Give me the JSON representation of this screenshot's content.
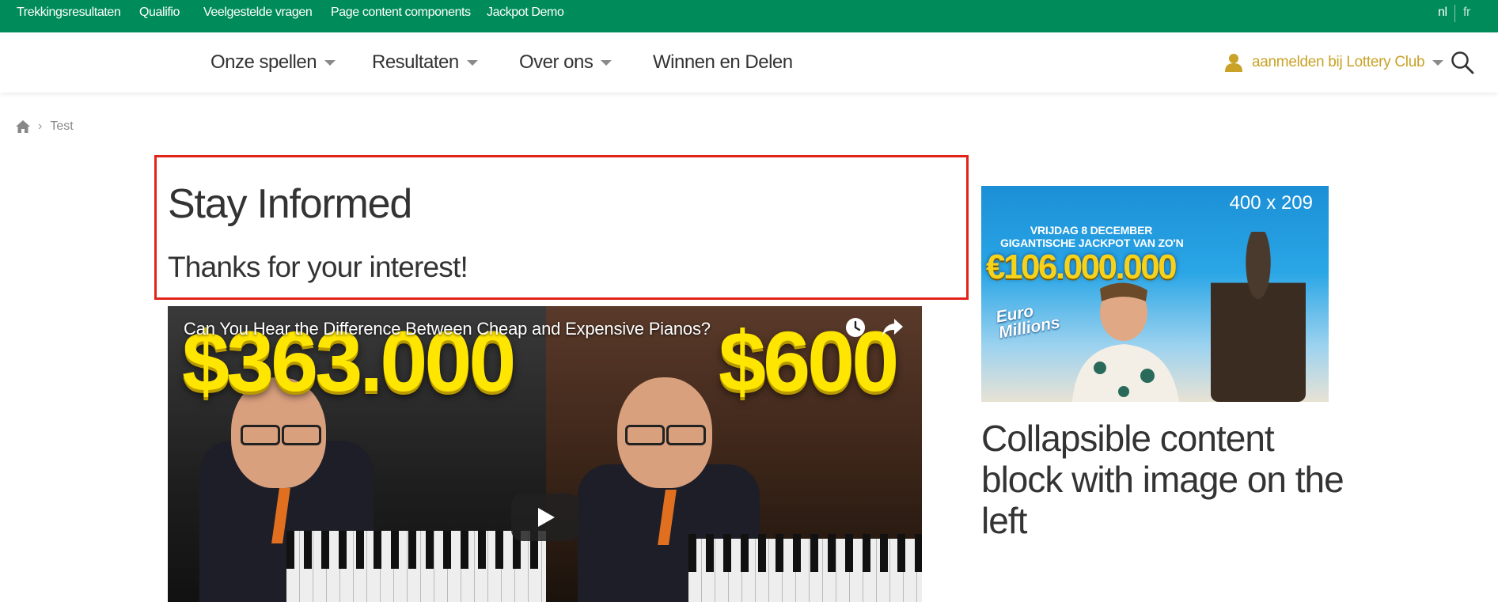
{
  "topbar": {
    "links": [
      "Trekkingsresultaten",
      "Qualifio",
      "Veelgestelde vragen",
      "Page content components",
      "Jackpot Demo"
    ],
    "languages": [
      "nl",
      "fr"
    ],
    "color": "#008c5a"
  },
  "nav": {
    "items": [
      "Onze spellen",
      "Resultaten",
      "Over ons",
      "Winnen en Delen"
    ],
    "login_label": "aanmelden bij Lottery Club",
    "accent_color": "#c9a227"
  },
  "breadcrumb": {
    "current": "Test"
  },
  "main": {
    "heading": "Stay Informed",
    "subheading": "Thanks for your interest!",
    "highlight_color": "#e2231a"
  },
  "video": {
    "title": "Can You Hear the Difference Between Cheap and Expensive Pianos?",
    "price_left": "$363.000",
    "price_right": "$600"
  },
  "ad": {
    "size_label": "400 x 209",
    "date_line1": "VRIJDAG 8 DECEMBER",
    "date_line2": "GIGANTISCHE JACKPOT VAN ZO'N",
    "jackpot": "€106.000.000",
    "logo_line1": "Euro",
    "logo_line2": "Millions"
  },
  "sidebar": {
    "title": "Collapsible content block with image on the left"
  }
}
